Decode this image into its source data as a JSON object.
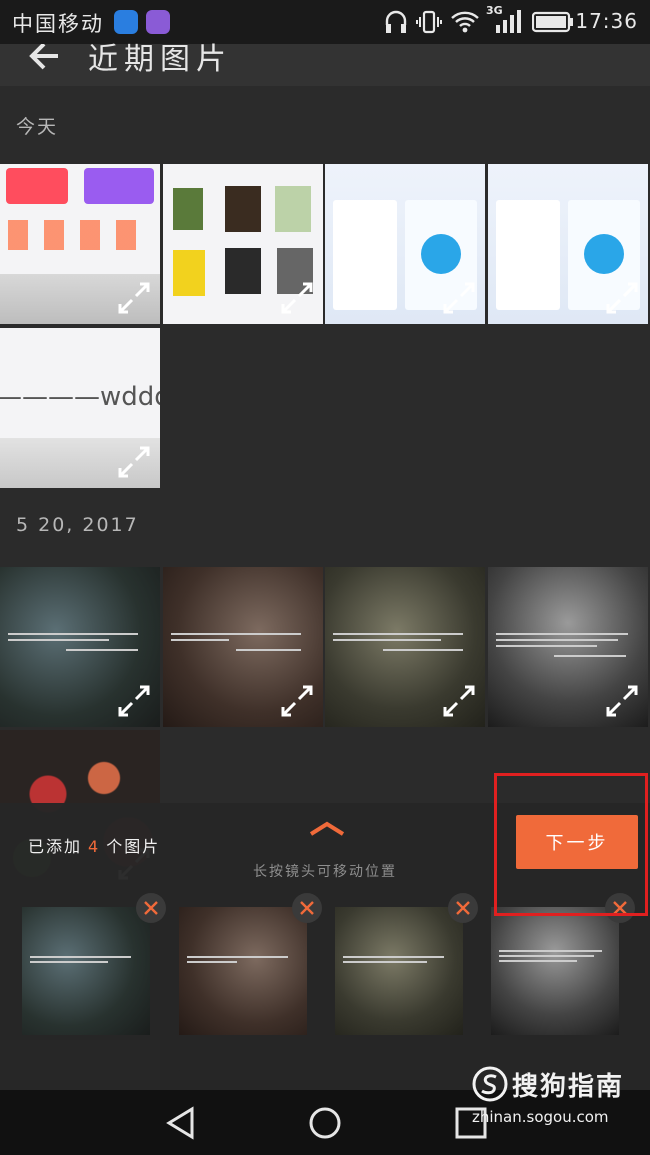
{
  "status": {
    "carrier": "中国移动",
    "network": "3G",
    "time": "17:36"
  },
  "header": {
    "title": "近期图片"
  },
  "sections": [
    {
      "label": "今天"
    },
    {
      "label": "5 20, 2017"
    }
  ],
  "thumb_text": {
    "wddd": "————wddd"
  },
  "tray": {
    "added_prefix": "已添加",
    "added_count": "4",
    "added_suffix": "个图片",
    "hint": "长按镜头可移动位置",
    "next_label": "下一步"
  },
  "watermark": {
    "brand": "搜狗指南",
    "url": "zhinan.sogou.com"
  },
  "colors": {
    "accent": "#f06a3a",
    "highlight": "#e02020"
  }
}
